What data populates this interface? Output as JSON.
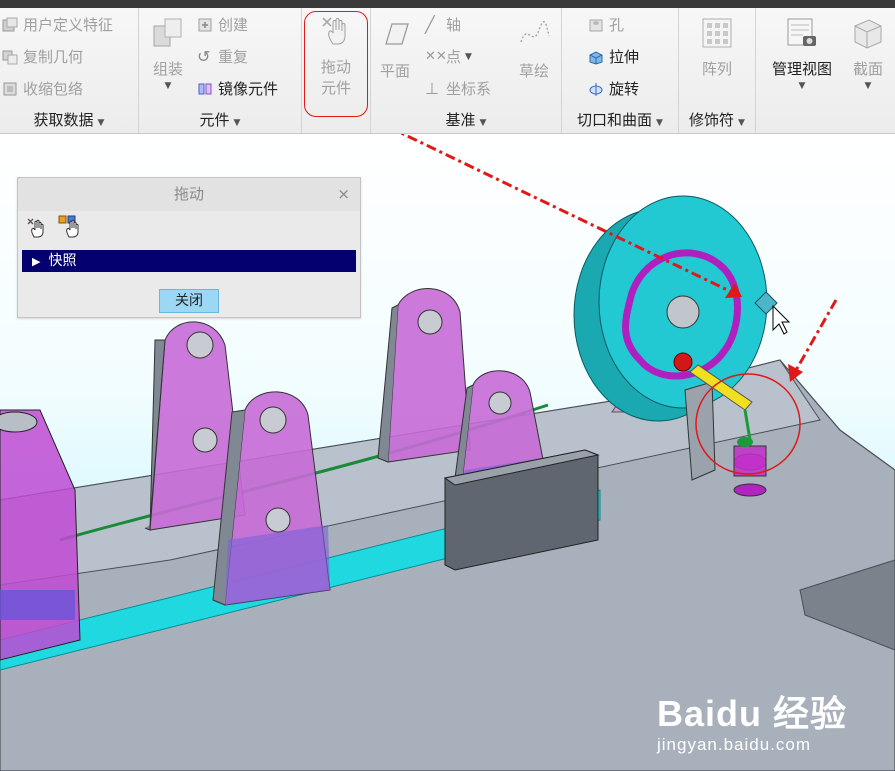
{
  "ribbon": {
    "get_data": {
      "items": [
        "用户定义特征",
        "复制几何",
        "收缩包络"
      ],
      "label": "获取数据"
    },
    "component": {
      "assemble": "组装",
      "create": "创建",
      "repeat": "重复",
      "mirror": "镜像元件",
      "label": "元件"
    },
    "drag": {
      "line1": "拖动",
      "line2": "元件"
    },
    "datum": {
      "plane": "平面",
      "axis": "轴",
      "point": "点",
      "csys": "坐标系",
      "sketch": "草绘",
      "label": "基准"
    },
    "cut_surface": {
      "hole": "孔",
      "extrude": "拉伸",
      "revolve": "旋转",
      "label": "切口和曲面"
    },
    "modifier": {
      "pattern": "阵列",
      "label": "修饰符"
    },
    "manage_view": "管理视图",
    "section": "截面"
  },
  "dialog": {
    "title": "拖动",
    "close_x": "×",
    "snapshot": "快照",
    "close_button": "关闭"
  },
  "watermark": {
    "brand": "Baidu 经验",
    "url": "jingyan.baidu.com"
  },
  "colors": {
    "accent_red": "#e01818",
    "snapshot_bar": "#04006f",
    "part_magenta": "#c040d0",
    "wheel_cyan": "#1cc4cc",
    "base_gray": "#9aa3ad"
  }
}
